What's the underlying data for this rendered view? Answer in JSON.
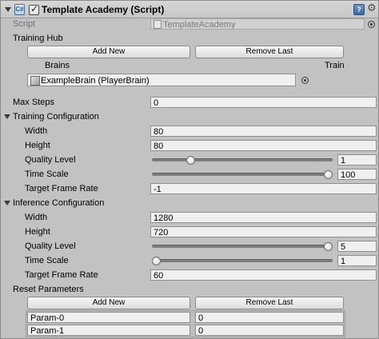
{
  "header": {
    "title": "Template Academy (Script)",
    "script_label": "Script",
    "script_value": "TemplateAcademy"
  },
  "training_hub": {
    "label": "Training Hub",
    "add_new": "Add New",
    "remove_last": "Remove Last",
    "brains_header": "Brains",
    "train_header": "Train",
    "brain_value": "ExampleBrain (PlayerBrain)"
  },
  "max_steps": {
    "label": "Max Steps",
    "value": "0"
  },
  "training_config": {
    "label": "Training Configuration",
    "width_label": "Width",
    "width": "80",
    "height_label": "Height",
    "height": "80",
    "quality_label": "Quality Level",
    "quality": "1",
    "quality_fraction": 0.2,
    "timescale_label": "Time Scale",
    "timescale": "100",
    "timescale_fraction": 1.0,
    "framerate_label": "Target Frame Rate",
    "framerate": "-1"
  },
  "inference_config": {
    "label": "Inference Configuration",
    "width_label": "Width",
    "width": "1280",
    "height_label": "Height",
    "height": "720",
    "quality_label": "Quality Level",
    "quality": "5",
    "quality_fraction": 1.0,
    "timescale_label": "Time Scale",
    "timescale": "1",
    "timescale_fraction": 0.0,
    "framerate_label": "Target Frame Rate",
    "framerate": "60"
  },
  "reset_parameters": {
    "label": "Reset Parameters",
    "add_new": "Add New",
    "remove_last": "Remove Last",
    "params": [
      {
        "name": "Param-0",
        "value": "0"
      },
      {
        "name": "Param-1",
        "value": "0"
      }
    ]
  }
}
